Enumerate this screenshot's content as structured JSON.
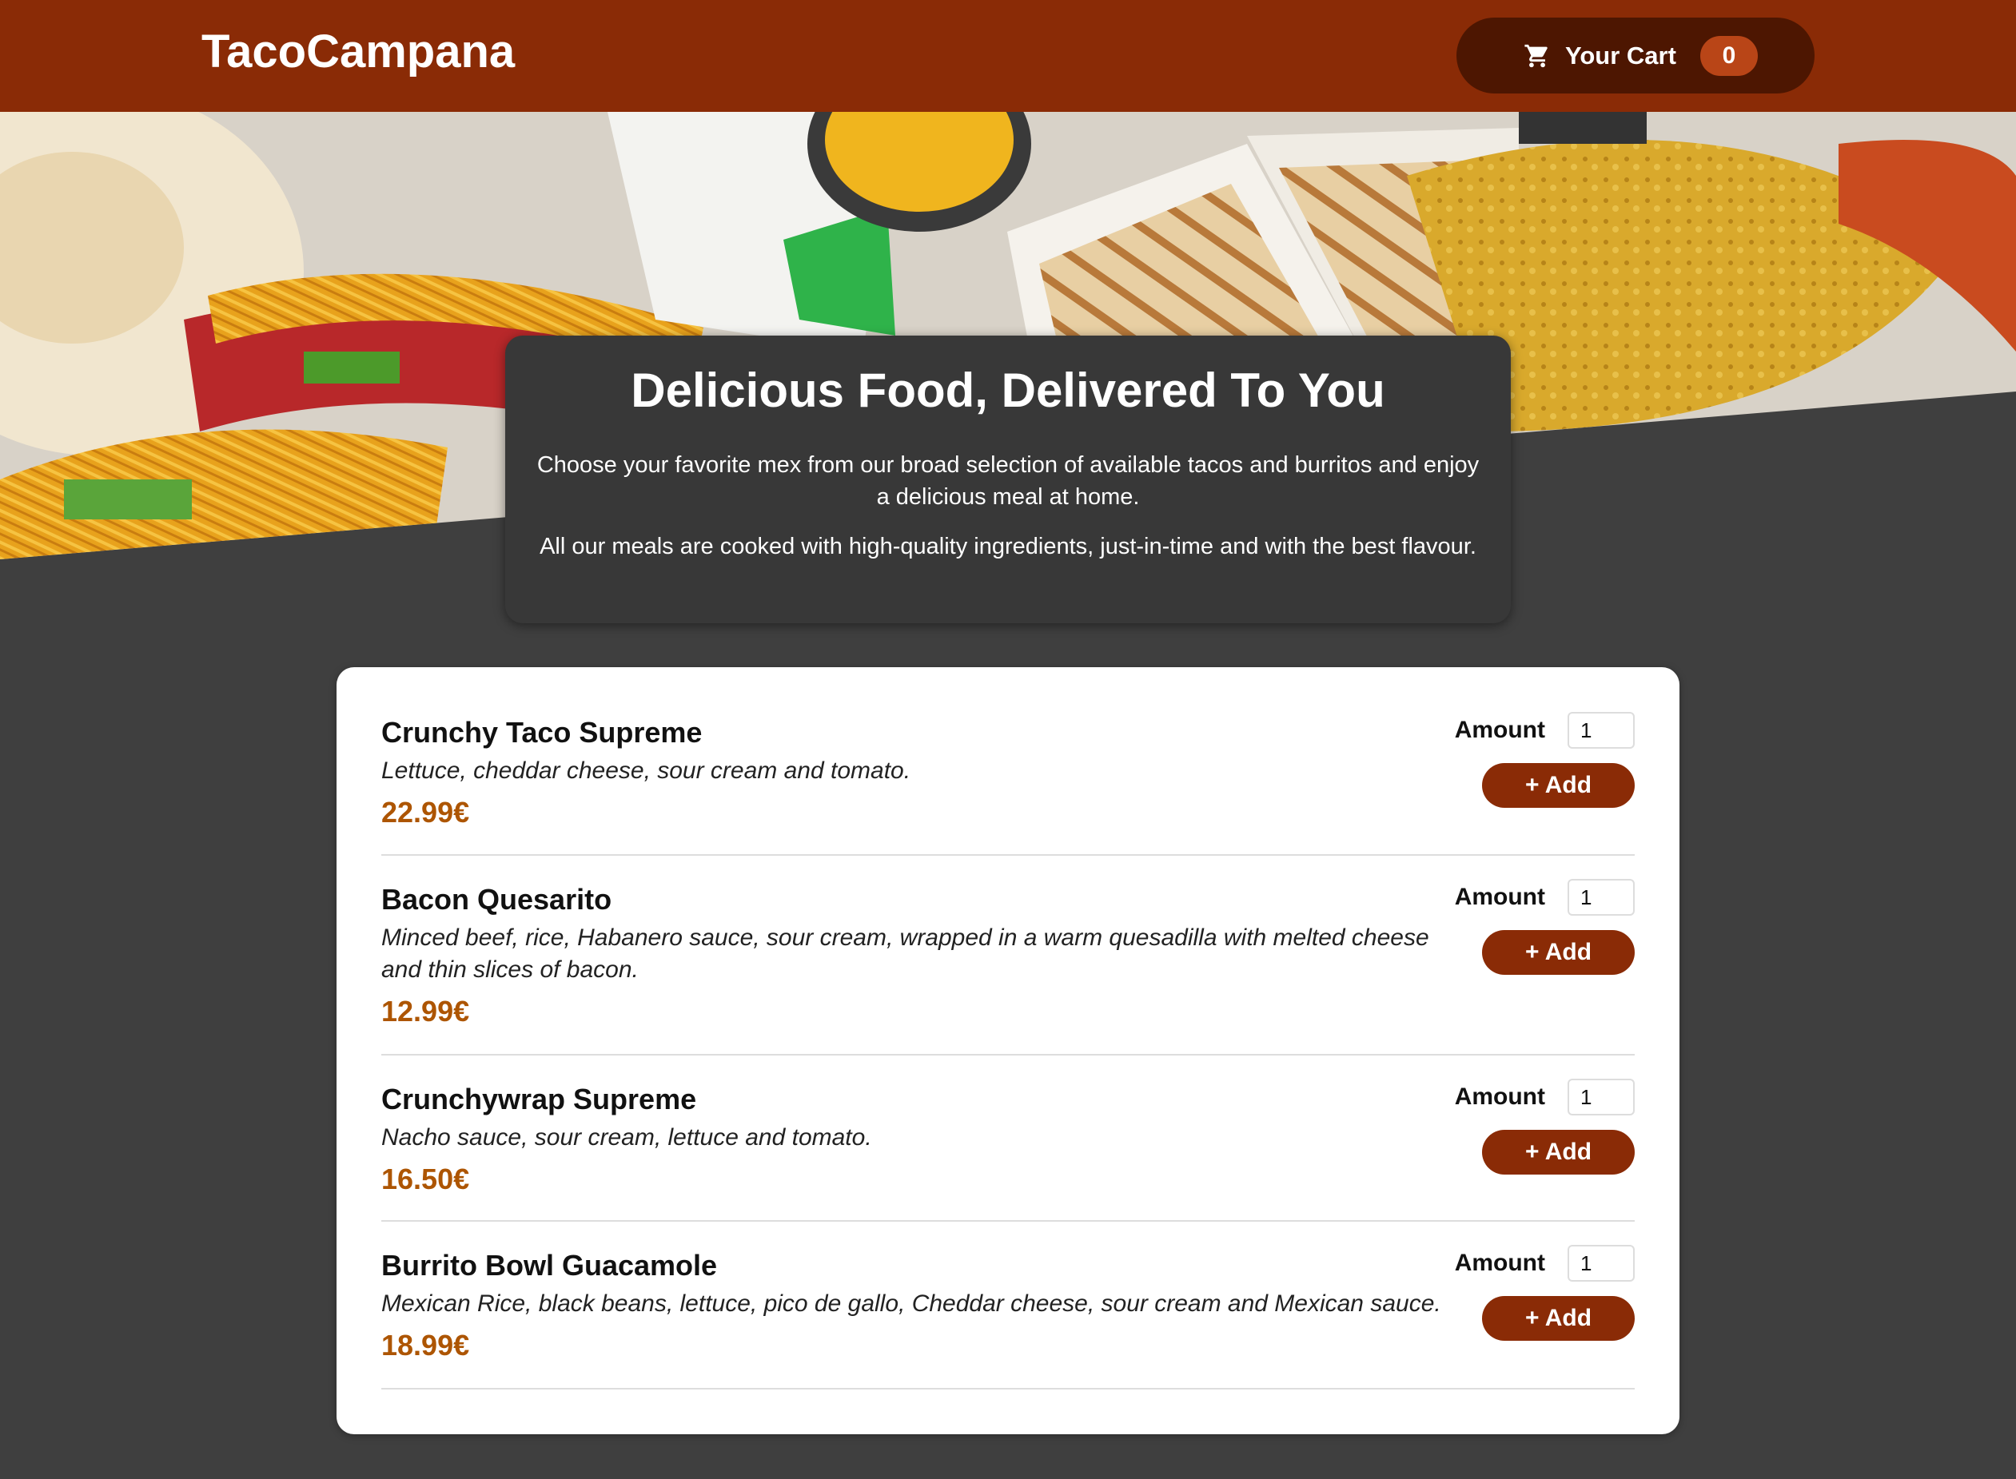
{
  "header": {
    "brand": "TacoCampana",
    "cart": {
      "icon": "cart-icon",
      "label": "Your Cart",
      "count": "0"
    }
  },
  "hero": {
    "image_desc": "overhead photo of tacos, burritos and quesadillas"
  },
  "summary": {
    "title": "Delicious Food, Delivered To You",
    "paragraph1": "Choose your favorite mex from our broad selection of available tacos and burritos and enjoy a delicious meal at home.",
    "paragraph2": "All our meals are cooked with high-quality ingredients, just-in-time and with the best flavour."
  },
  "menu": {
    "meals": [
      {
        "name": "Crunchy Taco Supreme",
        "description": "Lettuce, cheddar cheese, sour cream and tomato.",
        "price": "22.99€",
        "amount_label": "Amount",
        "amount_value": "1",
        "add_label": "+ Add"
      },
      {
        "name": "Bacon Quesarito",
        "description": "Minced beef, rice, Habanero sauce, sour cream, wrapped in a warm quesadilla with melted cheese and thin slices of bacon.",
        "price": "12.99€",
        "amount_label": "Amount",
        "amount_value": "1",
        "add_label": "+ Add"
      },
      {
        "name": "Crunchywrap Supreme",
        "description": "Nacho sauce, sour cream, lettuce and tomato.",
        "price": "16.50€",
        "amount_label": "Amount",
        "amount_value": "1",
        "add_label": "+ Add"
      },
      {
        "name": "Burrito Bowl Guacamole",
        "description": "Mexican Rice, black beans, lettuce, pico de gallo, Cheddar cheese, sour cream and Mexican sauce.",
        "price": "18.99€",
        "amount_label": "Amount",
        "amount_value": "1",
        "add_label": "+ Add"
      }
    ]
  },
  "colors": {
    "header_bg": "#8a2b06",
    "cart_bg": "#4d1601",
    "badge_bg": "#b94517",
    "page_bg": "#3f3f3f",
    "price": "#ad5502",
    "add_button": "#8a2b06"
  }
}
